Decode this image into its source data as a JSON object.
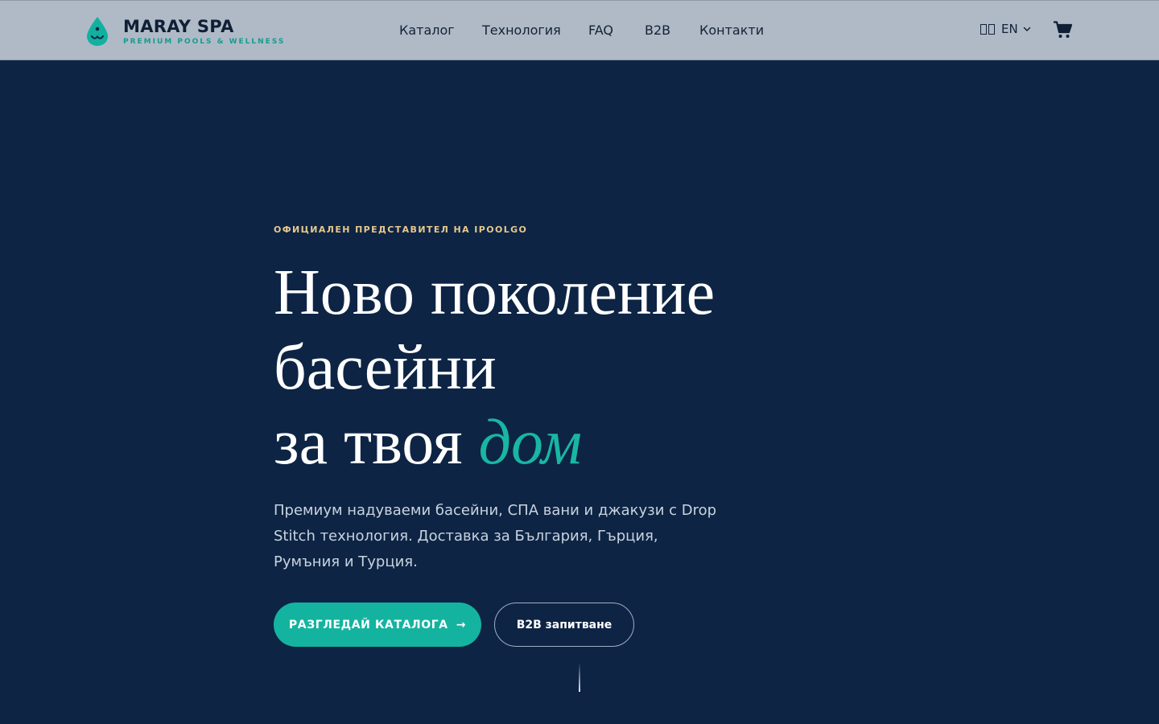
{
  "header": {
    "logo_title": "MARAY SPA",
    "logo_subtitle": "PREMIUM POOLS & WELLNESS",
    "nav": [
      "Каталог",
      "Технология",
      "FAQ",
      "B2B",
      "Контакти"
    ],
    "language": "EN"
  },
  "hero": {
    "eyebrow": "ОФИЦИАЛЕН ПРЕДСТАВИТЕЛ НА IPOOLGO",
    "headline_line1": "Ново поколение",
    "headline_line2": "басейни",
    "headline_line3_plain": "за твоя ",
    "headline_line3_accent": "дом",
    "description": "Премиум надуваеми басейни, СПА вани и джакузи с Drop Stitch технология. Доставка за България, Гърция, Румъния и Турция.",
    "primary_button": "РАЗГЛЕДАЙ КАТАЛОГА",
    "primary_button_arrow": "→",
    "secondary_button": "B2B запитване"
  },
  "colors": {
    "background": "#0d2444",
    "header": "#b0bac6",
    "accent": "#14b3a0",
    "eyebrow": "#e7c98d"
  },
  "icons": [
    "water-drop-logo-icon",
    "flag-icon",
    "chevron-down-icon",
    "cart-icon",
    "arrow-right-icon"
  ]
}
